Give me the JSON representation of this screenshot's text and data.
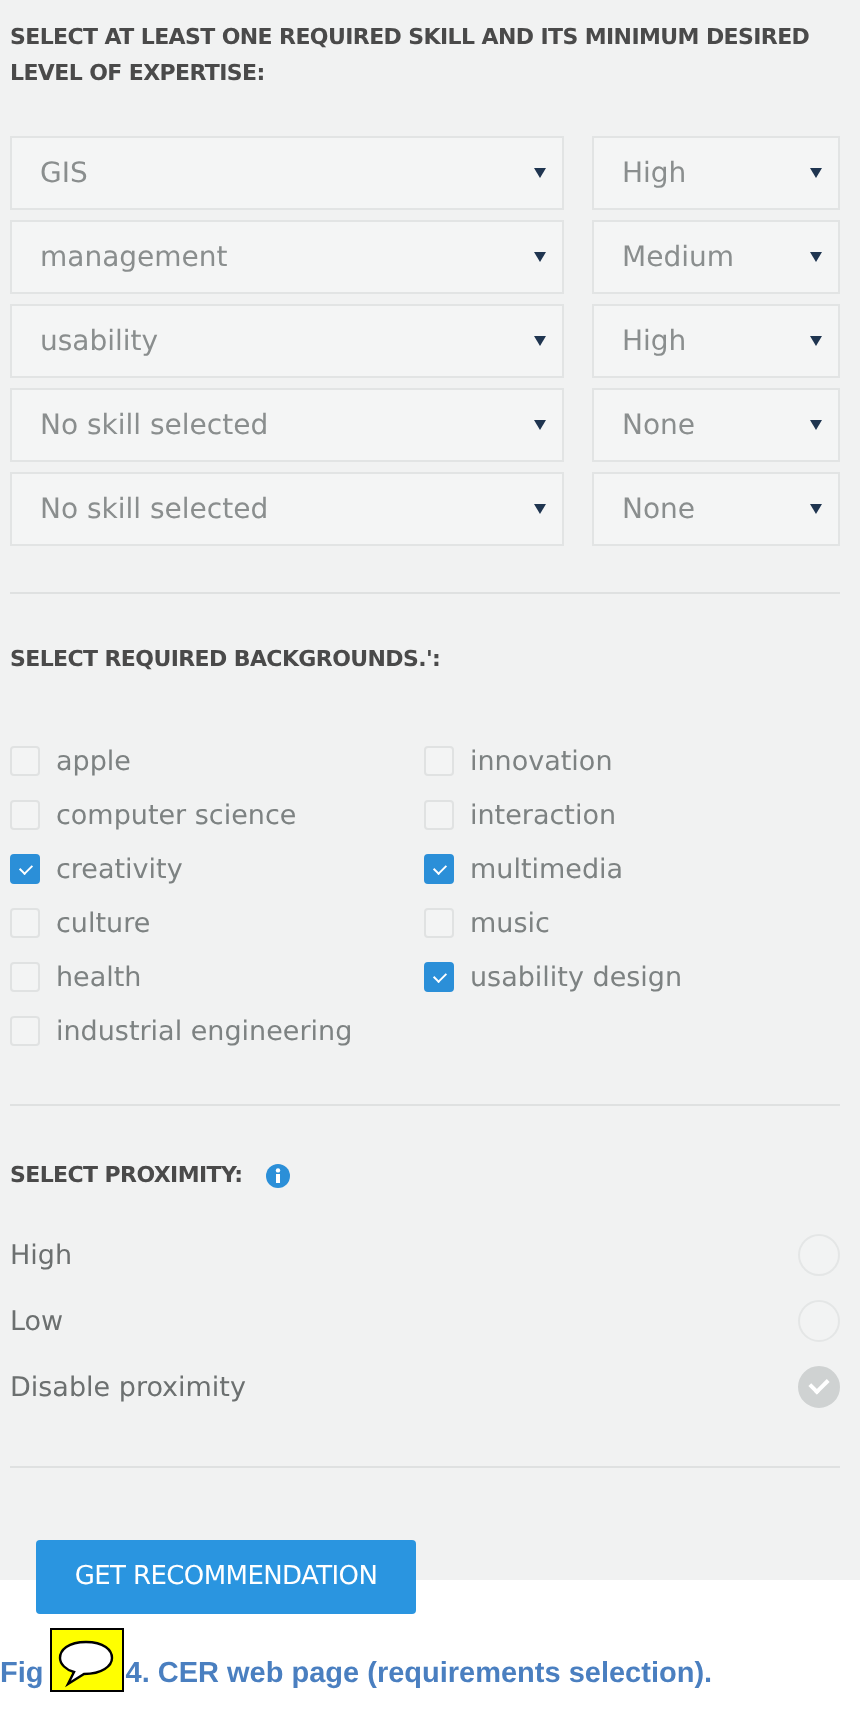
{
  "skills_section": {
    "heading": "SELECT AT LEAST ONE REQUIRED SKILL AND ITS MINIMUM DESIRED LEVEL OF EXPERTISE:",
    "rows": [
      {
        "skill": "GIS",
        "level": "High"
      },
      {
        "skill": "management",
        "level": "Medium"
      },
      {
        "skill": "usability",
        "level": "High"
      },
      {
        "skill": "No skill selected",
        "level": "None"
      },
      {
        "skill": "No skill selected",
        "level": "None"
      }
    ]
  },
  "backgrounds_section": {
    "heading": "SELECT REQUIRED BACKGROUNDS.':",
    "columns": [
      [
        {
          "label": "apple",
          "checked": false
        },
        {
          "label": "computer science",
          "checked": false
        },
        {
          "label": "creativity",
          "checked": true
        },
        {
          "label": "culture",
          "checked": false
        },
        {
          "label": "health",
          "checked": false
        },
        {
          "label": "industrial engineering",
          "checked": false
        }
      ],
      [
        {
          "label": "innovation",
          "checked": false
        },
        {
          "label": "interaction",
          "checked": false
        },
        {
          "label": "multimedia",
          "checked": true
        },
        {
          "label": "music",
          "checked": false
        },
        {
          "label": "usability design",
          "checked": true
        }
      ]
    ]
  },
  "proximity_section": {
    "heading": "SELECT PROXIMITY:",
    "options": [
      {
        "label": "High",
        "selected": false
      },
      {
        "label": "Low",
        "selected": false
      },
      {
        "label": "Disable proximity",
        "selected": true
      }
    ]
  },
  "submit_button": "GET RECOMMENDATION",
  "caption": {
    "start": "Fig",
    "rest": "4. CER web page (requirements selection)."
  }
}
